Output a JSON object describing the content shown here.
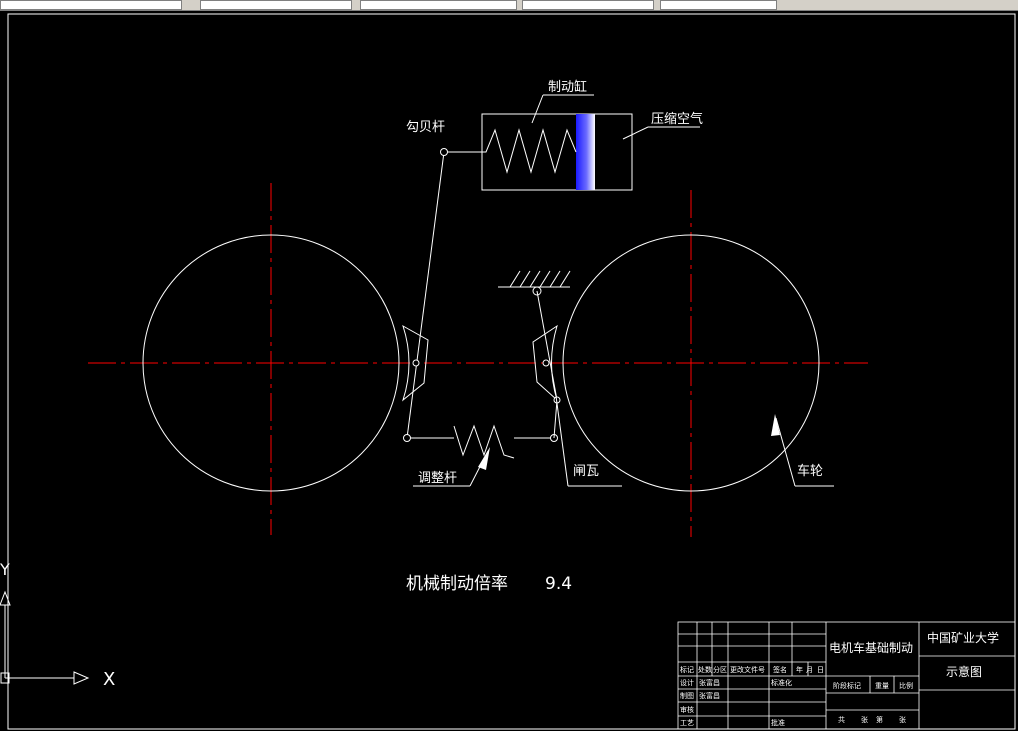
{
  "labels": {
    "brake_cylinder": "制动缸",
    "bell_crank": "勾贝杆",
    "compressed_air": "压缩空气",
    "adjust_rod": "调整杆",
    "brake_shoe": "闸瓦",
    "wheel": "车轮"
  },
  "ratio_label": "机械制动倍率",
  "ratio_value": "9.4",
  "title_block": {
    "drawing_title": "电机车基础制动",
    "school": "中国矿业大学",
    "sheet_name": "示意图",
    "header_row": [
      "标记",
      "处数",
      "分区",
      "更改文件号",
      "签名",
      "年",
      "月",
      "日"
    ],
    "rows": [
      {
        "left": "设计",
        "name": "张富昌",
        "mid": "标准化"
      },
      {
        "left": "制图",
        "name": "张富昌",
        "mid": ""
      },
      {
        "left": "审核",
        "name": "",
        "mid": ""
      },
      {
        "left": "工艺",
        "name": "",
        "mid": "批准"
      }
    ],
    "stage_headers": [
      "阶段标记",
      "重量",
      "比例"
    ],
    "sheet_count": [
      "共",
      "张",
      "第",
      "张"
    ]
  },
  "ucs": {
    "x_label": "X",
    "y_label": "Y"
  },
  "colors": {
    "background": "#000000",
    "line": "#ffffff",
    "centerline": "#ff0000",
    "piston": "#3a3aff"
  }
}
